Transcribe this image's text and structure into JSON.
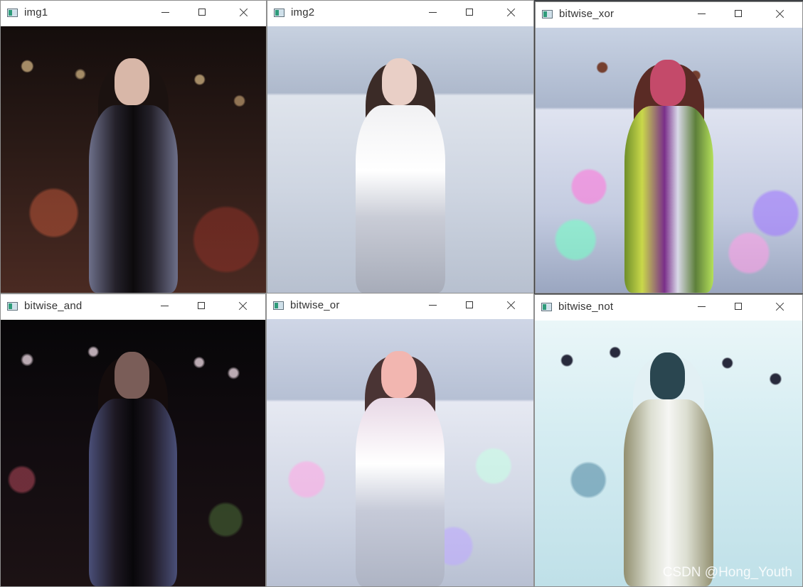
{
  "windows": [
    {
      "id": "img1",
      "title": "img1"
    },
    {
      "id": "img2",
      "title": "img2"
    },
    {
      "id": "bitwise_xor",
      "title": "bitwise_xor"
    },
    {
      "id": "bitwise_and",
      "title": "bitwise_and"
    },
    {
      "id": "bitwise_or",
      "title": "bitwise_or"
    },
    {
      "id": "bitwise_not",
      "title": "bitwise_not"
    }
  ],
  "watermark": "CSDN @Hong_Youth"
}
